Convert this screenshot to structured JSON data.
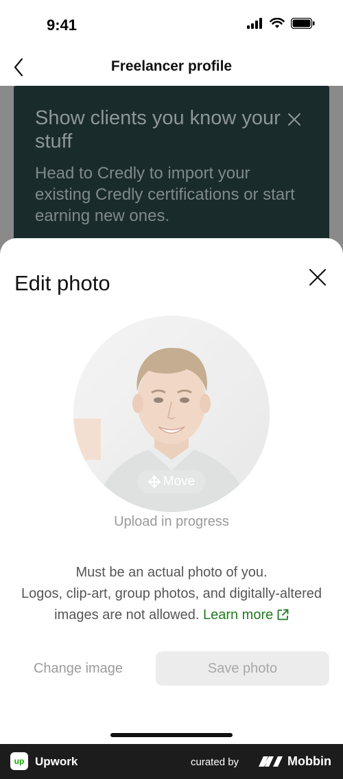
{
  "status_bar": {
    "time": "9:41"
  },
  "nav": {
    "title": "Freelancer profile"
  },
  "banner": {
    "title": "Show clients you know your stuff",
    "text": "Head to Credly to import your existing Credly certifications or start earning new ones."
  },
  "sheet": {
    "title": "Edit photo",
    "move_label": "Move",
    "upload_status": "Upload in progress",
    "guideline_line1": "Must be an actual photo of you.",
    "guideline_line2": "Logos, clip-art, group photos, and digitally-altered images are not allowed.",
    "learn_more": "Learn more",
    "change_image": "Change image",
    "save_photo": "Save photo"
  },
  "footer": {
    "app_logo": "up",
    "app_name": "Upwork",
    "curated_by": "curated by",
    "brand": "Mobbin"
  },
  "colors": {
    "banner_bg": "#1a2b2b",
    "link": "#1f7a1f",
    "footer_bg": "#1c1c1c",
    "upwork_green": "#14a800"
  }
}
